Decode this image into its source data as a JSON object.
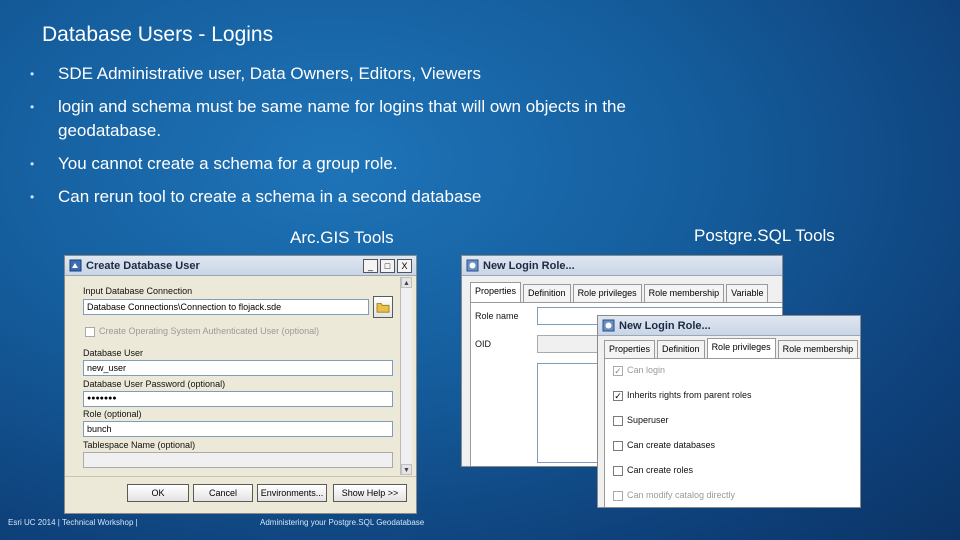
{
  "slide": {
    "title": "Database Users - Logins",
    "bullets": [
      "SDE Administrative user, Data Owners, Editors, Viewers",
      "login and schema must be same name for logins that will own objects in the geodatabase.",
      "You cannot create a schema for a group role.",
      "Can rerun tool to create a schema in a second database"
    ],
    "bullet_glyph": "•",
    "arcgis_label": "Arc.GIS Tools",
    "postgres_label": "Postgre.SQL Tools"
  },
  "create_db_user": {
    "title": "Create Database User",
    "win_min": "_",
    "win_max": "□",
    "win_close": "X",
    "input_conn_label": "Input Database Connection",
    "input_conn_value": "Database Connections\\Connection to flojack.sde",
    "os_auth_label": "Create Operating System Authenticated User (optional)",
    "db_user_label": "Database User",
    "db_user_value": "new_user",
    "password_label": "Database User Password (optional)",
    "password_value": "●●●●●●●",
    "role_label": "Role (optional)",
    "role_value": "bunch",
    "tablespace_label": "Tablespace Name (optional)",
    "tablespace_value": "",
    "ok": "OK",
    "cancel": "Cancel",
    "environments": "Environments...",
    "show_help": "Show Help >>",
    "scroll_up": "▲",
    "scroll_down": "▼"
  },
  "new_login_role_back": {
    "title": "New Login Role...",
    "tabs": [
      "Properties",
      "Definition",
      "Role privileges",
      "Role membership",
      "Variable"
    ],
    "role_name_label": "Role name",
    "oid_label": "OID"
  },
  "new_login_role_front": {
    "title": "New Login Role...",
    "tabs": [
      "Properties",
      "Definition",
      "Role privileges",
      "Role membership"
    ],
    "check_mark": "✓",
    "privileges": [
      {
        "label": "Can login",
        "checked": true,
        "disabled": true
      },
      {
        "label": "Inherits rights from parent roles",
        "checked": true,
        "disabled": false
      },
      {
        "label": "Superuser",
        "checked": false,
        "disabled": false
      },
      {
        "label": "Can create databases",
        "checked": false,
        "disabled": false
      },
      {
        "label": "Can create roles",
        "checked": false,
        "disabled": false
      },
      {
        "label": "Can modify catalog directly",
        "checked": false,
        "disabled": true
      }
    ]
  },
  "footer": {
    "left": "Esri UC 2014 | Technical Workshop |",
    "center": "Administering your Postgre.SQL Geodatabase"
  }
}
